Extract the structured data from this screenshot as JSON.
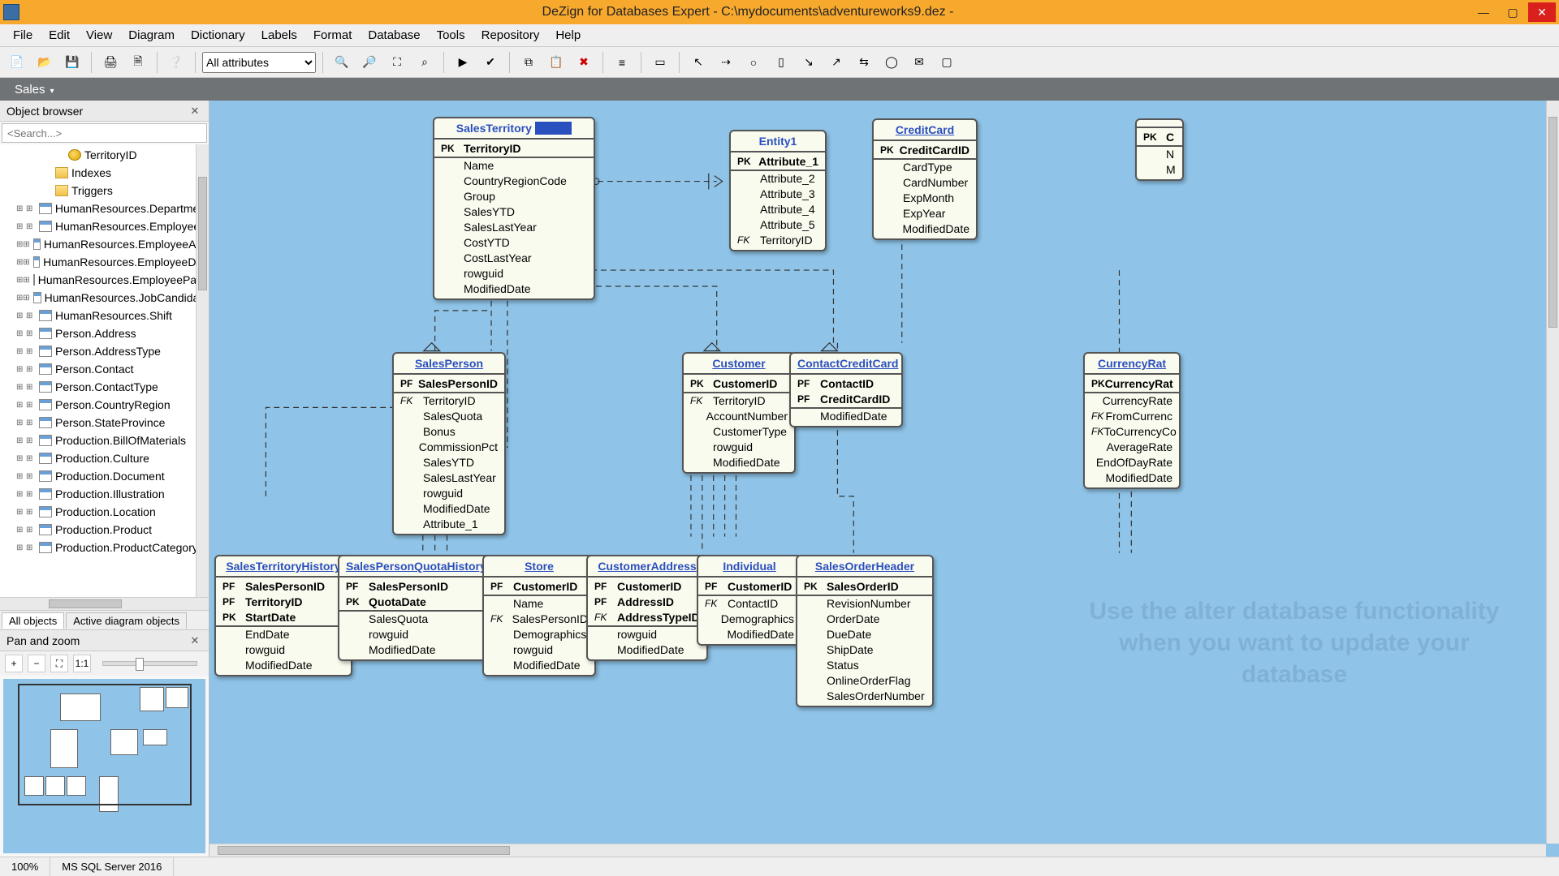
{
  "title": "DeZign for Databases Expert - C:\\mydocuments\\adventureworks9.dez -",
  "menus": [
    "File",
    "Edit",
    "View",
    "Diagram",
    "Dictionary",
    "Labels",
    "Format",
    "Database",
    "Tools",
    "Repository",
    "Help"
  ],
  "toolbar_combo": "All attributes",
  "active_tab": "Sales",
  "object_browser": {
    "title": "Object browser",
    "search_placeholder": "<Search...>",
    "top_nodes": [
      {
        "icon": "key",
        "label": "TerritoryID",
        "indent": 80
      },
      {
        "icon": "folder",
        "label": "Indexes",
        "indent": 64
      },
      {
        "icon": "folder",
        "label": "Triggers",
        "indent": 64
      }
    ],
    "tables": [
      "HumanResources.Department",
      "HumanResources.Employee",
      "HumanResources.EmployeeAdd",
      "HumanResources.EmployeeDep",
      "HumanResources.EmployeePayH",
      "HumanResources.JobCandidate",
      "HumanResources.Shift",
      "Person.Address",
      "Person.AddressType",
      "Person.Contact",
      "Person.ContactType",
      "Person.CountryRegion",
      "Person.StateProvince",
      "Production.BillOfMaterials",
      "Production.Culture",
      "Production.Document",
      "Production.Illustration",
      "Production.Location",
      "Production.Product",
      "Production.ProductCategory"
    ],
    "tabs": [
      "All objects",
      "Active diagram objects"
    ]
  },
  "panzoom_title": "Pan and zoom",
  "entities": {
    "salesTerritory": {
      "title": "SalesTerritory",
      "selected": true,
      "header": [
        [
          "PK",
          "TerritoryID"
        ]
      ],
      "rows": [
        [
          "",
          "Name"
        ],
        [
          "",
          "CountryRegionCode"
        ],
        [
          "",
          "Group"
        ],
        [
          "",
          "SalesYTD"
        ],
        [
          "",
          "SalesLastYear"
        ],
        [
          "",
          "CostYTD"
        ],
        [
          "",
          "CostLastYear"
        ],
        [
          "",
          "rowguid"
        ],
        [
          "",
          "ModifiedDate"
        ]
      ]
    },
    "entity1": {
      "title": "Entity1",
      "header": [
        [
          "PK",
          "Attribute_1"
        ]
      ],
      "rows": [
        [
          "",
          "Attribute_2"
        ],
        [
          "",
          "Attribute_3"
        ],
        [
          "",
          "Attribute_4"
        ],
        [
          "",
          "Attribute_5"
        ],
        [
          "FK",
          "TerritoryID"
        ]
      ]
    },
    "creditCard": {
      "title": "CreditCard",
      "header": [
        [
          "PK",
          "CreditCardID"
        ]
      ],
      "rows": [
        [
          "",
          "CardType"
        ],
        [
          "",
          "CardNumber"
        ],
        [
          "",
          "ExpMonth"
        ],
        [
          "",
          "ExpYear"
        ],
        [
          "",
          "ModifiedDate"
        ]
      ]
    },
    "partial1": {
      "title": "",
      "header": [
        [
          "PK",
          "C"
        ]
      ],
      "rows": [
        [
          "",
          "N"
        ],
        [
          "",
          "M"
        ]
      ]
    },
    "salesPerson": {
      "title": "SalesPerson",
      "header": [
        [
          "PF",
          "SalesPersonID"
        ]
      ],
      "rows": [
        [
          "FK",
          "TerritoryID"
        ],
        [
          "",
          "SalesQuota"
        ],
        [
          "",
          "Bonus"
        ],
        [
          "",
          "CommissionPct"
        ],
        [
          "",
          "SalesYTD"
        ],
        [
          "",
          "SalesLastYear"
        ],
        [
          "",
          "rowguid"
        ],
        [
          "",
          "ModifiedDate"
        ],
        [
          "",
          "Attribute_1"
        ]
      ]
    },
    "customer": {
      "title": "Customer",
      "header": [
        [
          "PK",
          "CustomerID"
        ]
      ],
      "rows": [
        [
          "FK",
          "TerritoryID"
        ],
        [
          "",
          "AccountNumber"
        ],
        [
          "",
          "CustomerType"
        ],
        [
          "",
          "rowguid"
        ],
        [
          "",
          "ModifiedDate"
        ]
      ]
    },
    "contactCreditCard": {
      "title": "ContactCreditCard",
      "header": [
        [
          "PF",
          "ContactID"
        ],
        [
          "PF",
          "CreditCardID"
        ]
      ],
      "rows": [
        [
          "",
          "ModifiedDate"
        ]
      ]
    },
    "currencyRate": {
      "title": "CurrencyRat",
      "header": [
        [
          "PK",
          "CurrencyRat"
        ]
      ],
      "rows": [
        [
          "",
          "CurrencyRate"
        ],
        [
          "FK",
          "FromCurrenc"
        ],
        [
          "FK",
          "ToCurrencyCo"
        ],
        [
          "",
          "AverageRate"
        ],
        [
          "",
          "EndOfDayRate"
        ],
        [
          "",
          "ModifiedDate"
        ]
      ]
    },
    "salesTerritoryHistory": {
      "title": "SalesTerritoryHistory",
      "header": [
        [
          "PF",
          "SalesPersonID"
        ],
        [
          "PF",
          "TerritoryID"
        ],
        [
          "PK",
          "StartDate"
        ]
      ],
      "rows": [
        [
          "",
          "EndDate"
        ],
        [
          "",
          "rowguid"
        ],
        [
          "",
          "ModifiedDate"
        ]
      ]
    },
    "salesPersonQuotaHistory": {
      "title": "SalesPersonQuotaHistory",
      "header": [
        [
          "PF",
          "SalesPersonID"
        ],
        [
          "PK",
          "QuotaDate"
        ]
      ],
      "rows": [
        [
          "",
          "SalesQuota"
        ],
        [
          "",
          "rowguid"
        ],
        [
          "",
          "ModifiedDate"
        ]
      ]
    },
    "store": {
      "title": "Store",
      "header": [
        [
          "PF",
          "CustomerID"
        ]
      ],
      "rows": [
        [
          "",
          "Name"
        ],
        [
          "FK",
          "SalesPersonID"
        ],
        [
          "",
          "Demographics"
        ],
        [
          "",
          "rowguid"
        ],
        [
          "",
          "ModifiedDate"
        ]
      ]
    },
    "customerAddress": {
      "title": "CustomerAddress",
      "header": [
        [
          "PF",
          "CustomerID"
        ],
        [
          "PF",
          "AddressID"
        ],
        [
          "FK",
          "AddressTypeID"
        ]
      ],
      "rows": [
        [
          "",
          "rowguid"
        ],
        [
          "",
          "ModifiedDate"
        ]
      ]
    },
    "individual": {
      "title": "Individual",
      "header": [
        [
          "PF",
          "CustomerID"
        ]
      ],
      "rows": [
        [
          "FK",
          "ContactID"
        ],
        [
          "",
          "Demographics"
        ],
        [
          "",
          "ModifiedDate"
        ]
      ]
    },
    "salesOrderHeader": {
      "title": "SalesOrderHeader",
      "header": [
        [
          "PK",
          "SalesOrderID"
        ]
      ],
      "rows": [
        [
          "",
          "RevisionNumber"
        ],
        [
          "",
          "OrderDate"
        ],
        [
          "",
          "DueDate"
        ],
        [
          "",
          "ShipDate"
        ],
        [
          "",
          "Status"
        ],
        [
          "",
          "OnlineOrderFlag"
        ],
        [
          "",
          "SalesOrderNumber"
        ]
      ]
    }
  },
  "status": {
    "zoom": "100%",
    "db": "MS SQL Server 2016"
  },
  "watermark": "Use the alter database functionality when you want to update your database"
}
